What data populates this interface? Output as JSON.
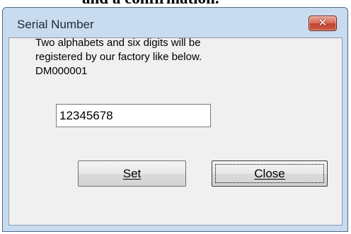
{
  "top_text": "and a confirmation.",
  "dialog": {
    "title": "Serial Number",
    "close_icon": "close-icon",
    "message_lines": [
      "Two alphabets and six digits will be",
      "registered by our factory like below.",
      "DM000001"
    ],
    "serial_value": "12345678",
    "set_label": "Set",
    "close_label": "Close"
  }
}
